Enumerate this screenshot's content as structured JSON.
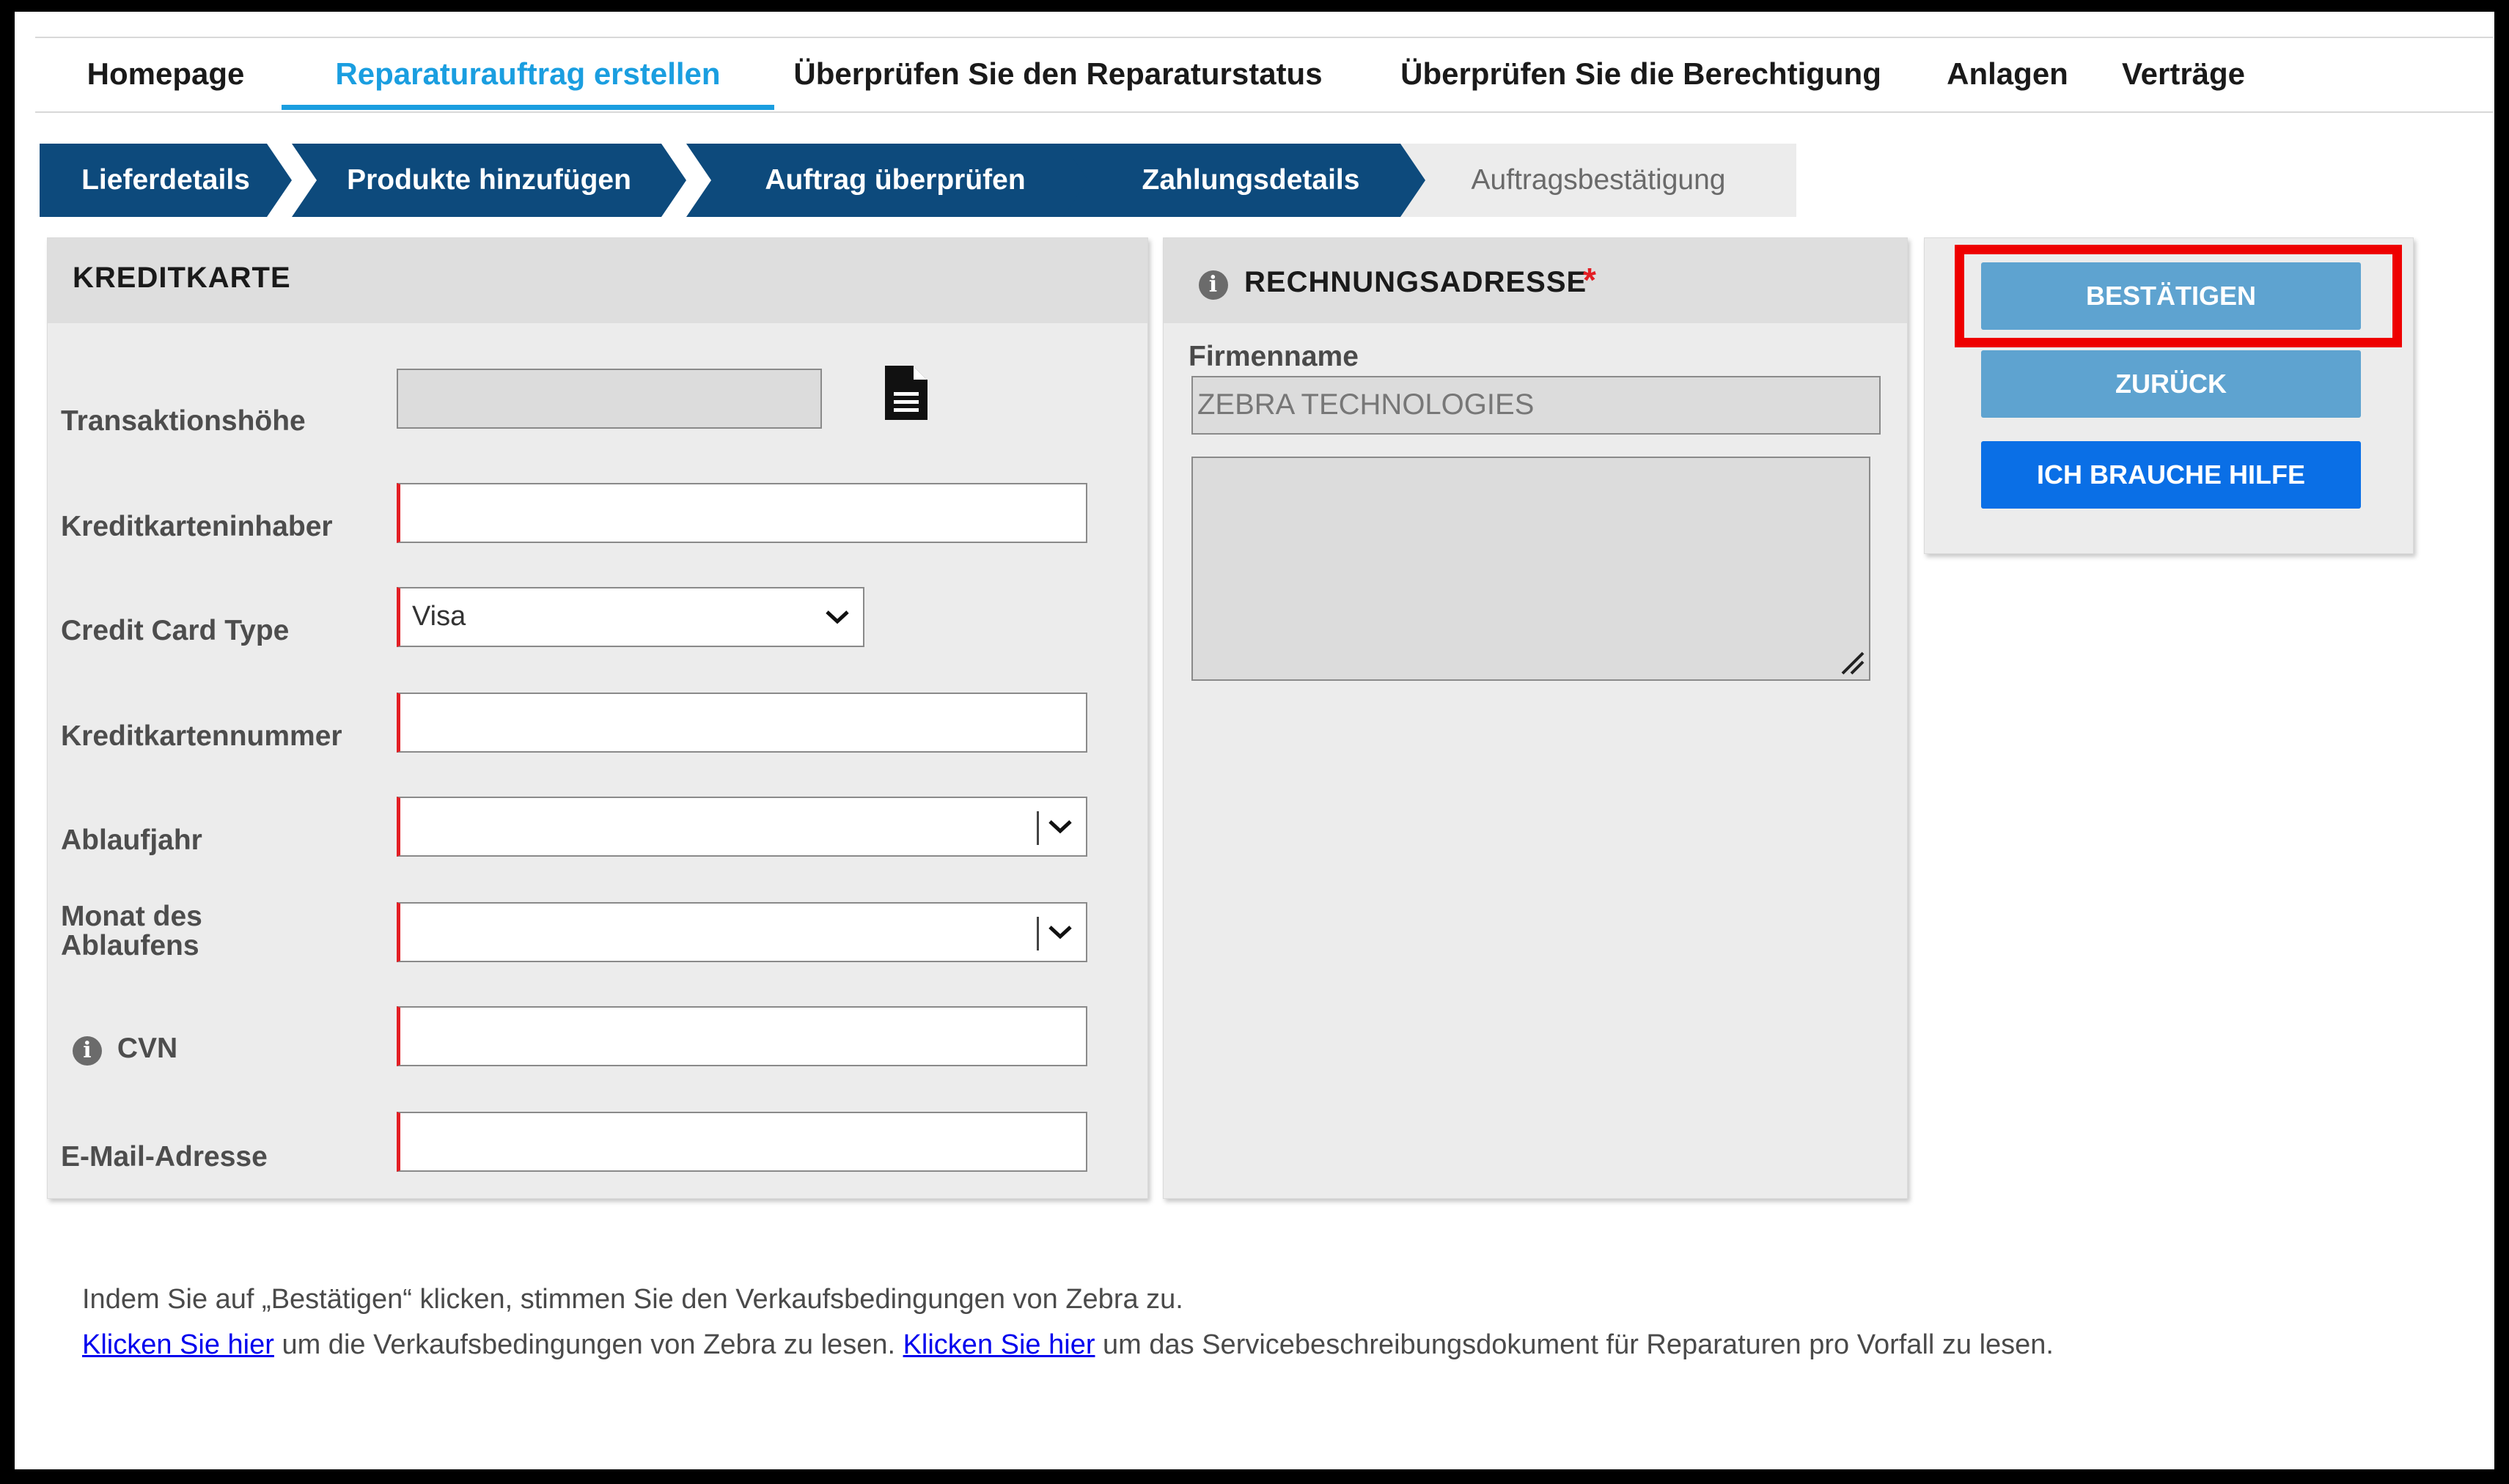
{
  "nav": {
    "tabs": [
      {
        "label": "Homepage"
      },
      {
        "label": "Reparaturauftrag erstellen",
        "active": true
      },
      {
        "label": "Überprüfen Sie den Reparaturstatus"
      },
      {
        "label": "Überprüfen Sie die Berechtigung"
      },
      {
        "label": "Anlagen"
      },
      {
        "label": "Verträge"
      }
    ]
  },
  "steps": [
    {
      "label": "Lieferdetails"
    },
    {
      "label": "Produkte hinzufügen"
    },
    {
      "label": "Auftrag überprüfen"
    },
    {
      "label": "Zahlungsdetails"
    },
    {
      "label": "Auftragsbestätigung"
    }
  ],
  "credit_card": {
    "title": "KREDITKARTE",
    "fields": {
      "amount": {
        "label": "Transaktionshöhe",
        "value": ""
      },
      "holder": {
        "label": "Kreditkarteninhaber",
        "value": ""
      },
      "type": {
        "label": "Credit Card Type",
        "value": "Visa"
      },
      "number": {
        "label": "Kreditkartennummer",
        "value": ""
      },
      "expiry_year": {
        "label": "Ablaufjahr",
        "value": ""
      },
      "expiry_month": {
        "label_line1": "Monat des",
        "label_line2": "Ablaufens",
        "value": ""
      },
      "cvn": {
        "label": "CVN",
        "value": ""
      },
      "email": {
        "label": "E-Mail-Adresse",
        "value": ""
      }
    }
  },
  "billing": {
    "title": "RECHNUNGSADRESSE",
    "required_mark": "*",
    "company_label": "Firmenname",
    "company_value": "ZEBRA TECHNOLOGIES",
    "address_value": ""
  },
  "actions": {
    "confirm": "BESTÄTIGEN",
    "back": "ZURÜCK",
    "help": "ICH BRAUCHE HILFE"
  },
  "footer": {
    "line1": "Indem Sie auf „Bestätigen“ klicken, stimmen Sie den Verkaufsbedingungen von Zebra zu.",
    "link1": "Klicken Sie hier",
    "text1": " um die Verkaufsbedingungen von Zebra zu lesen. ",
    "link2": "Klicken Sie hier",
    "text2": " um das Servicebeschreibungsdokument für Reparaturen pro Vorfall zu lesen."
  },
  "colors": {
    "nav_active": "#1a9ee0",
    "step_bg": "#0d4a7c",
    "required": "#e31e24",
    "button_light": "#5ea3d0",
    "button_blue": "#0a6fe6",
    "highlight": "#ee0000"
  }
}
